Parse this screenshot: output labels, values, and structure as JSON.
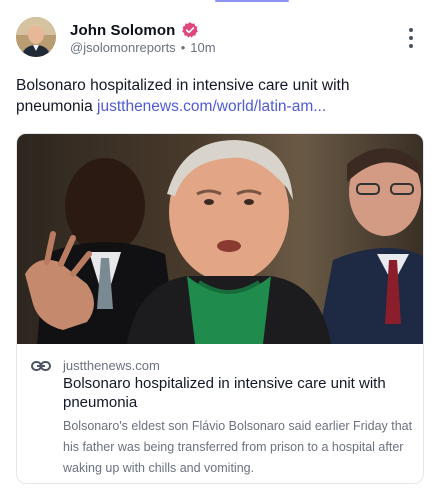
{
  "author": {
    "name": "John Solomon",
    "handle": "@jsolomonreports",
    "separator": "•",
    "time": "10m"
  },
  "post": {
    "text": "Bolsonaro hospitalized in intensive care unit with pneumonia",
    "link": "justthenews.com/world/latin-am..."
  },
  "link_card": {
    "domain": "justthenews.com",
    "title": "Bolsonaro hospitalized in intensive care unit with pneumonia",
    "description": "Bolsonaro's eldest son Flávio Bolsonaro said earlier Friday that his father was being transferred from prison to a hospital after waking up with chills and vomiting."
  },
  "icons": {
    "verified": "verified-badge-icon",
    "menu": "more-vertical-icon",
    "link": "link-icon"
  },
  "colors": {
    "link": "#4f5bd5",
    "verified": "#e0457b",
    "muted": "#6b7280",
    "text": "#111827"
  }
}
